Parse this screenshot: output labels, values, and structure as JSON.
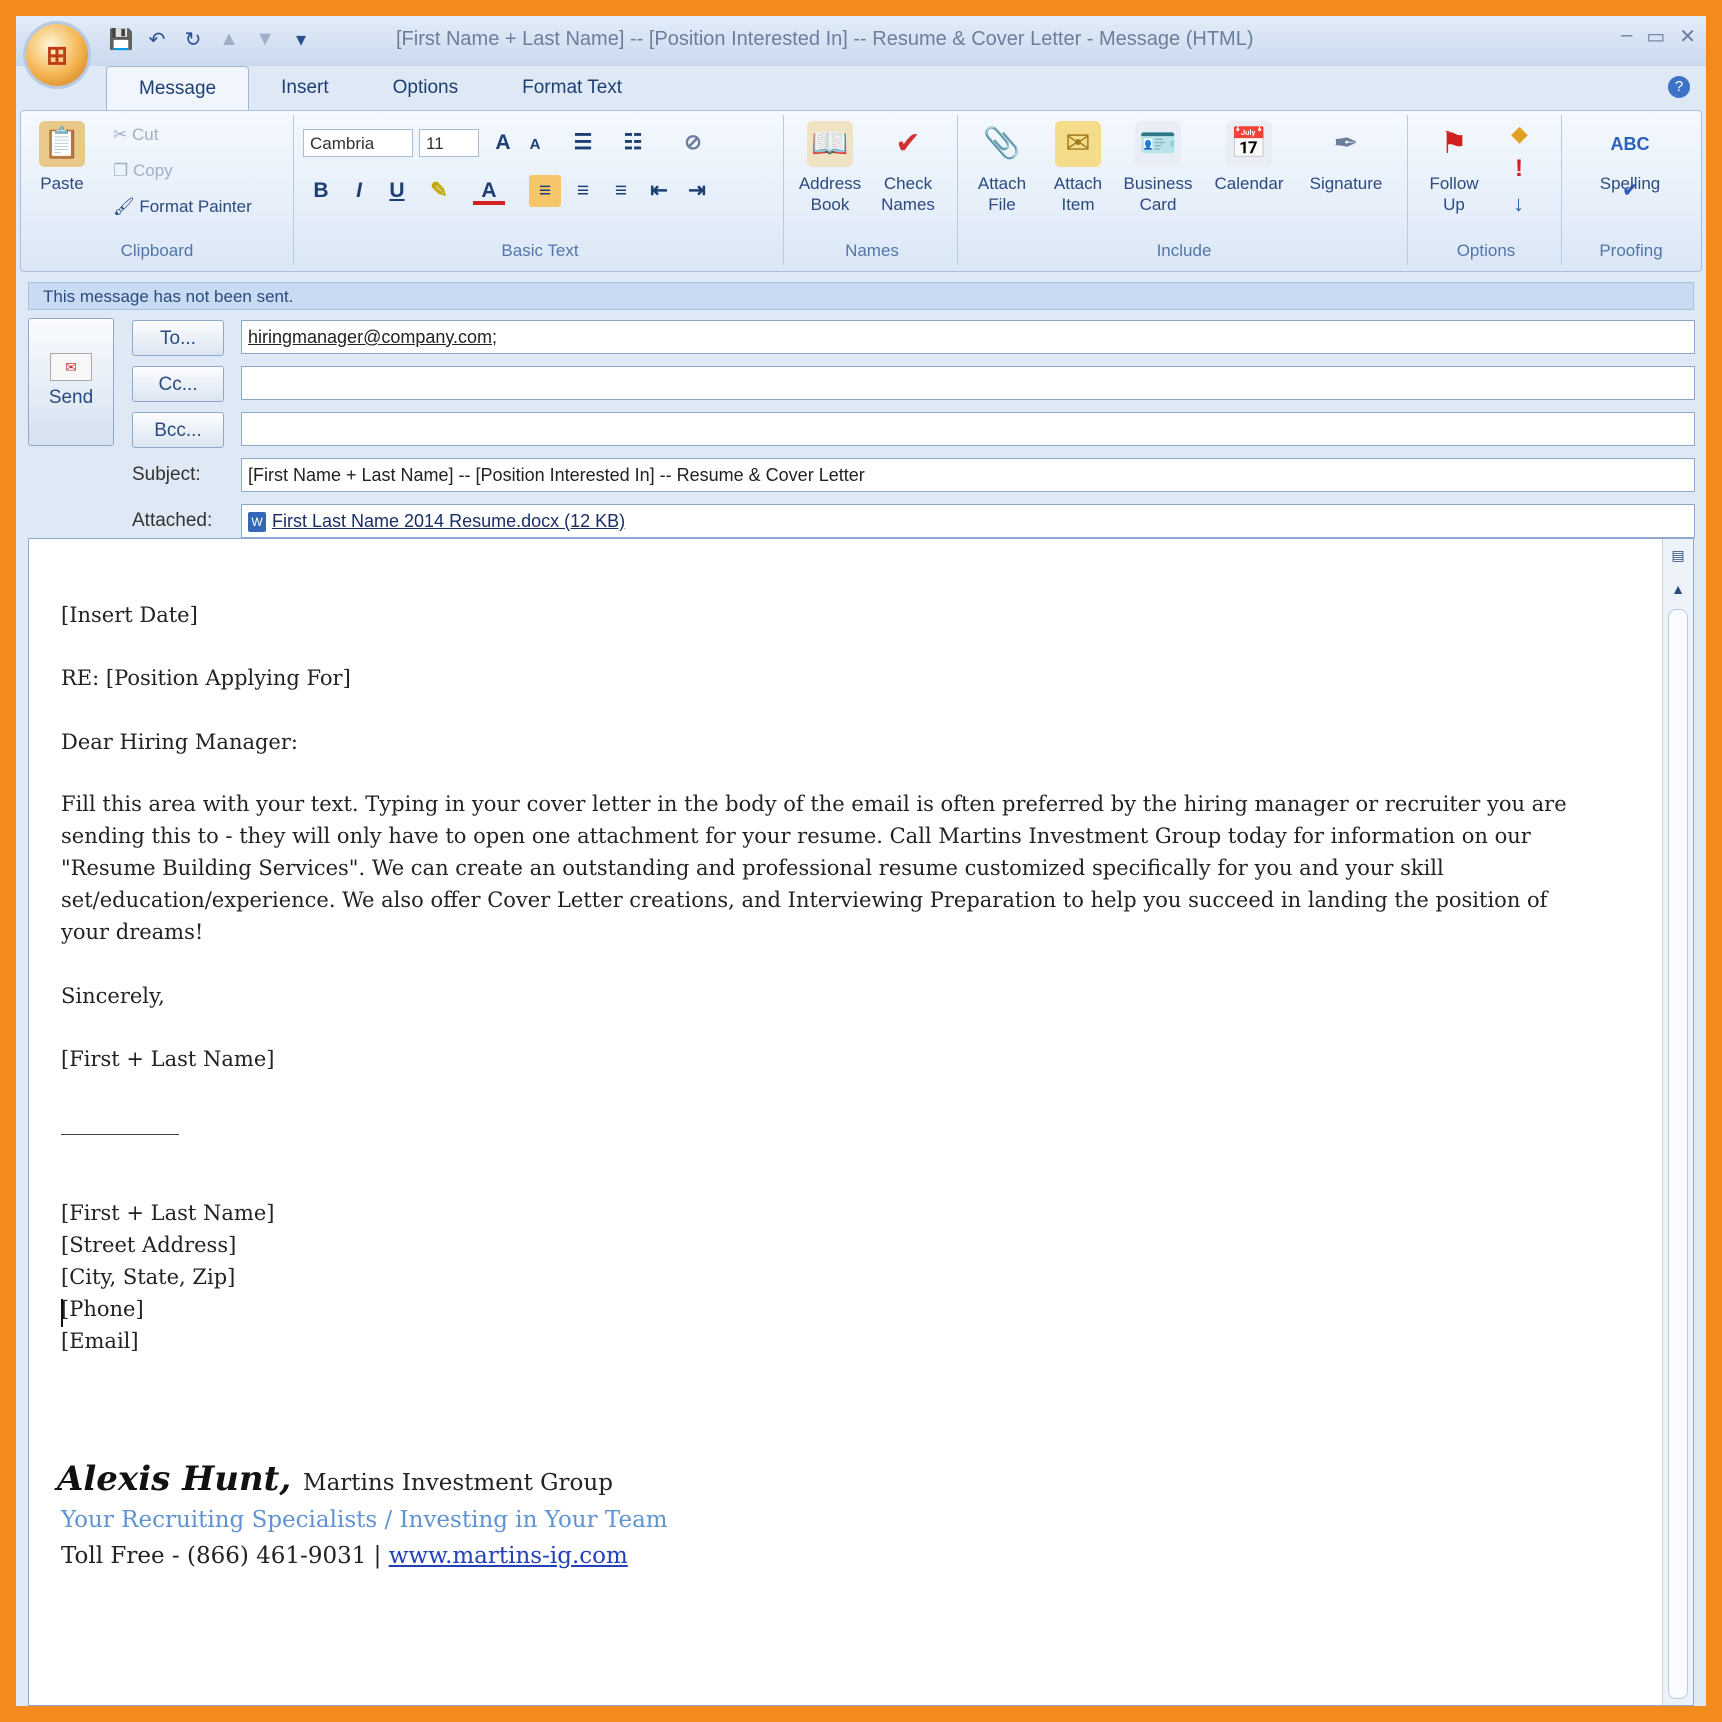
{
  "window": {
    "title": "[First Name + Last Name] -- [Position Interested In] -- Resume & Cover Letter - Message (HTML)",
    "controls": [
      "–",
      "▭",
      "✕"
    ]
  },
  "tabs": [
    {
      "label": "Message",
      "active": true
    },
    {
      "label": "Insert",
      "active": false
    },
    {
      "label": "Options",
      "active": false
    },
    {
      "label": "Format Text",
      "active": false
    }
  ],
  "ribbon": {
    "clipboard": {
      "label": "Clipboard",
      "paste": "Paste",
      "cut": "Cut",
      "copy": "Copy",
      "format_painter": "Format Painter"
    },
    "basic_text": {
      "label": "Basic Text",
      "font": "Cambria",
      "size": "11",
      "bold": "B",
      "italic": "I",
      "underline": "U"
    },
    "names": {
      "label": "Names",
      "address_book": "Address Book",
      "check_names": "Check Names"
    },
    "include": {
      "label": "Include",
      "attach_file": "Attach File",
      "attach_item": "Attach Item",
      "business_card": "Business Card",
      "calendar": "Calendar",
      "signature": "Signature"
    },
    "options": {
      "label": "Options",
      "follow_up": "Follow Up"
    },
    "proofing": {
      "label": "Proofing",
      "spelling": "Spelling",
      "spelling_icon_text": "ABC"
    }
  },
  "infobar": "This message has not been sent.",
  "header": {
    "send_label": "Send",
    "to_button": "To...",
    "cc_button": "Cc...",
    "bcc_button": "Bcc...",
    "to_value": "hiringmanager@company.com;",
    "cc_value": "",
    "bcc_value": "",
    "subject_label": "Subject:",
    "subject_value": "[First Name + Last Name] -- [Position Interested In] -- Resume & Cover Letter",
    "attached_label": "Attached:",
    "attachment": "First Last Name 2014 Resume.docx (12 KB)"
  },
  "letter": {
    "date": "[Insert Date]",
    "re": "RE: [Position Applying For]",
    "salutation": "Dear Hiring Manager:",
    "body": "Fill this area with your text. Typing in your cover letter in the body of the email is often preferred by the hiring manager or recruiter you are sending this to - they will only have to open one attachment for your resume. Call Martins Investment Group today for information on our \"Resume Building Services\". We can create an outstanding and professional resume customized specifically for you and your skill set/education/experience. We also offer Cover Letter creations, and Interviewing Preparation to help you succeed in landing the position of your dreams!",
    "closing": "Sincerely,",
    "name": "[First + Last Name]",
    "contact": [
      "[First + Last Name]",
      "[Street Address]",
      "[City, State, Zip]",
      "[Phone]",
      "[Email]"
    ]
  },
  "signature": {
    "name": "Alexis Hunt,",
    "company": "Martins Investment Group",
    "tagline": "Your Recruiting Specialists / Investing in Your Team",
    "phone": "Toll Free - (866) 461-9031 |",
    "website": "www.martins-ig.com"
  }
}
